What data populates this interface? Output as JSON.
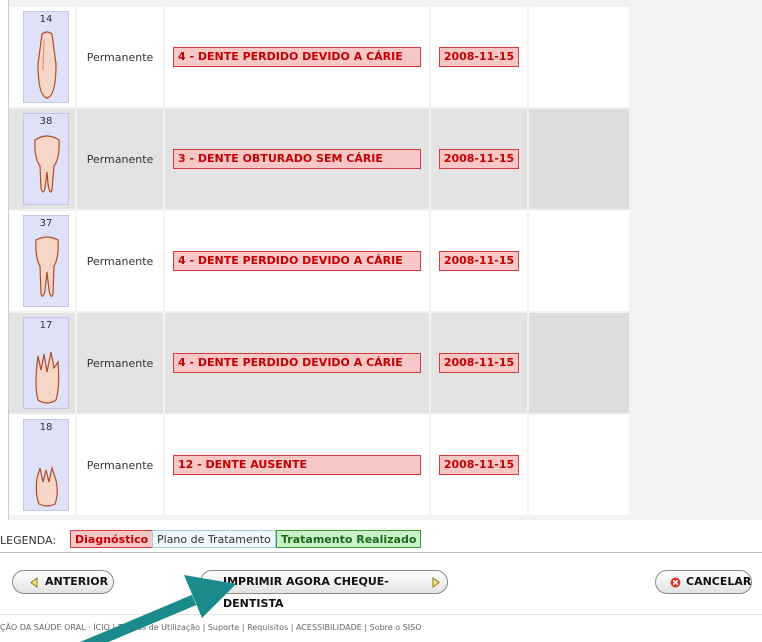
{
  "rows": [
    {
      "tooth": "14",
      "type": "Permanente",
      "diagnosis": "4 - DENTE PERDIDO DEVIDO A CÁRIE",
      "date": "2008-11-15"
    },
    {
      "tooth": "38",
      "type": "Permanente",
      "diagnosis": "3 - DENTE OBTURADO SEM CÁRIE",
      "date": "2008-11-15"
    },
    {
      "tooth": "37",
      "type": "Permanente",
      "diagnosis": "4 - DENTE PERDIDO DEVIDO A CÁRIE",
      "date": "2008-11-15"
    },
    {
      "tooth": "17",
      "type": "Permanente",
      "diagnosis": "4 - DENTE PERDIDO DEVIDO A CÁRIE",
      "date": "2008-11-15"
    },
    {
      "tooth": "18",
      "type": "Permanente",
      "diagnosis": "12 - DENTE AUSENTE",
      "date": "2008-11-15"
    }
  ],
  "legend": {
    "label": "LEGENDA:",
    "diagnostico": "Diagnóstico",
    "plano": "Plano de Tratamento",
    "realizado": "Tratamento Realizado"
  },
  "buttons": {
    "prev": "ANTERIOR",
    "print": "IMPRIMIR AGORA CHEQUE-DENTISTA",
    "cancel": "CANCELAR"
  },
  "footer": "ÇÃO DA SAÚDE ORAL · ÍCIO | Termos de Utilização | Suporte | Requisitos | ACESSIBILIDADE | Sobre o SISO",
  "colors": {
    "accent": "#1a8a8a",
    "diagnosis_bg": "#f7c7c7",
    "diagnosis_border": "#d23c3c"
  }
}
